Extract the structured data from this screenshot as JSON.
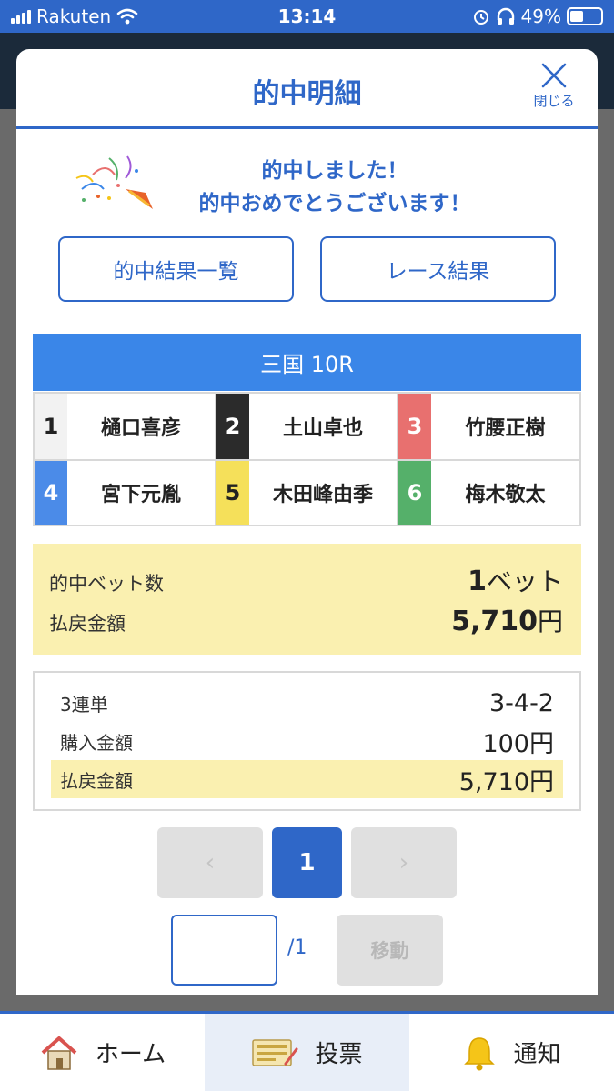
{
  "status_bar": {
    "carrier": "Rakuten",
    "time": "13:14",
    "battery": "49%"
  },
  "modal": {
    "title": "的中明細",
    "close_label": "閉じる",
    "congrats_line1": "的中しました！",
    "congrats_line2": "的中おめでとうございます！",
    "buttons": {
      "hit_list": "的中結果一覧",
      "race_result": "レース結果"
    }
  },
  "race": {
    "title": "三国 10R",
    "racers": [
      {
        "num": "1",
        "name": "樋口喜彦",
        "color": "#f2f2f2",
        "text_color": "#222222"
      },
      {
        "num": "2",
        "name": "土山卓也",
        "color": "#2b2b2b",
        "text_color": "#ffffff"
      },
      {
        "num": "3",
        "name": "竹腰正樹",
        "color": "#e8706f",
        "text_color": "#ffffff"
      },
      {
        "num": "4",
        "name": "宮下元胤",
        "color": "#4b8be8",
        "text_color": "#ffffff"
      },
      {
        "num": "5",
        "name": "木田峰由季",
        "color": "#f5e05a",
        "text_color": "#222222"
      },
      {
        "num": "6",
        "name": "梅木敬太",
        "color": "#55b06a",
        "text_color": "#ffffff"
      }
    ]
  },
  "summary": {
    "bets_label": "的中ベット数",
    "bets_value": "1",
    "bets_unit": "ベット",
    "payout_label": "払戻金額",
    "payout_value": "5,710",
    "payout_unit": "円"
  },
  "detail": {
    "type_label": "3連単",
    "type_value": "3-4-2",
    "purchase_label": "購入金額",
    "purchase_value": "100円",
    "payout_label": "払戻金額",
    "payout_value": "5,710円"
  },
  "pager": {
    "prev": "‹",
    "current": "1",
    "next": "›",
    "total": "/1",
    "goto_label": "移動",
    "input_value": ""
  },
  "tabbar": {
    "home": "ホーム",
    "vote": "投票",
    "notify": "通知"
  }
}
